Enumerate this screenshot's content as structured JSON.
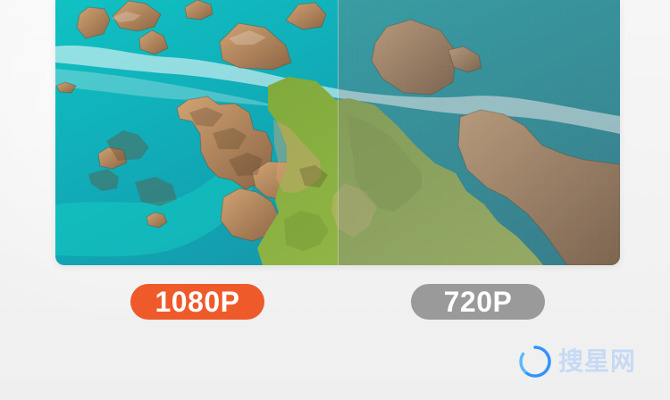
{
  "resolution_labels": {
    "left": "1080P",
    "right": "720P"
  },
  "watermark": {
    "text": "搜星网",
    "icon": "swirl-logo-icon",
    "color": "#7cb4ff"
  },
  "colors": {
    "left_label_bg": "#ef5a2a",
    "right_label_bg": "#9a9a9a",
    "page_bg": "#f1f1f1",
    "sea": "#18b6b2",
    "grass": "#8bb244",
    "rock": "#b88a5e"
  }
}
